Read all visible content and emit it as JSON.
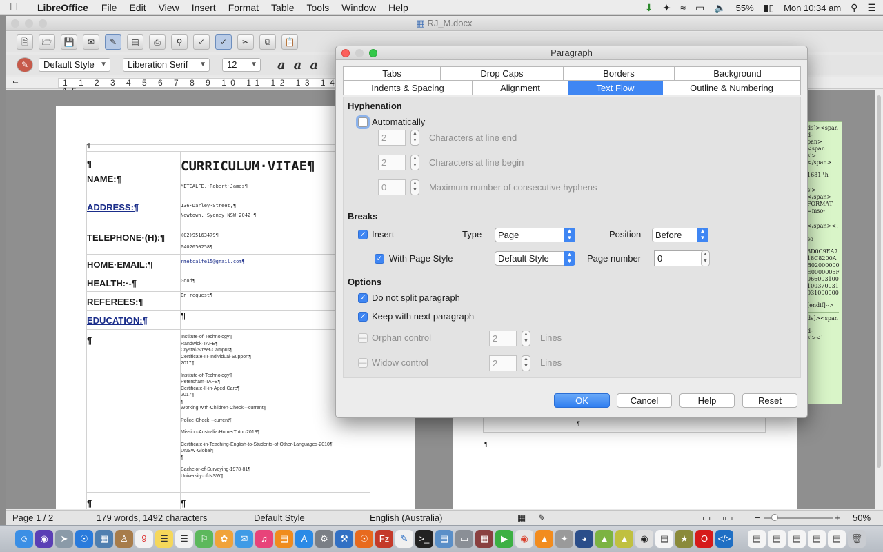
{
  "menubar": {
    "app_name": "LibreOffice",
    "items": [
      "File",
      "Edit",
      "View",
      "Insert",
      "Format",
      "Table",
      "Tools",
      "Window",
      "Help"
    ],
    "battery": "55%",
    "clock": "Mon 10:34 am"
  },
  "window": {
    "title": "RJ_M.docx"
  },
  "formatting": {
    "paragraph_style": "Default Style",
    "font_name": "Liberation Serif",
    "font_size": "12"
  },
  "ruler": {
    "marks": "1 1 2 3 4 5 6 7 8 9 10 11 12 13 14 15"
  },
  "document": {
    "cv_title": "CURRICULUM·VITAE¶",
    "name_label": "NAME:¶",
    "name_value": "METCALFE,·Robert·James¶",
    "address_label": "ADDRESS:¶",
    "address_line1": "136·Darley·Street,¶",
    "address_line2": "Newtown,·Sydney·NSW·2042·¶",
    "telephone_label": "TELEPHONE·(H):¶",
    "telephone1": "(02)95163479¶",
    "telephone2": "0402050258¶",
    "email_label": "HOME·EMAIL:¶",
    "email_value": "rmetcalfe15@gmail.com¶",
    "health_label": "HEALTH:·-¶",
    "health_value": "Good¶",
    "referees_label": "REFEREES:¶",
    "referees_value": "On·request¶",
    "education_label": "EDUCATION:¶",
    "education_lines": [
      "Institute·of·Technology¶",
      "Randwick·TAFE¶",
      "Crystal·Street·Campus¶",
      "Certificate·III·Individual·Support¶",
      "2017¶",
      "",
      "Institute·of·Technology¶",
      "Petersham·TAFE¶",
      "Certificate·II·in·Aged·Care¶",
      "2017¶",
      "¶",
      "Working·with·Children·Check·-·current¶",
      "",
      "Police·Check·-·current¶",
      "",
      "Mission·Australia·Home·Tutor·2013¶",
      "",
      "Certificate·in·Teaching·English·to·Students·of·Other·Languages·2010¶",
      "UNSW·Global¶",
      "¶",
      "",
      "Bachelor·of·Surveying·1978-81¶",
      "University·of·NSW¶"
    ],
    "pilcrow": "¶"
  },
  "markup_panel": {
    "lines_a": [
      "ds]><span",
      "d-",
      "pan><span",
      "s'> </span>",
      "1681 \\h",
      "s'> </span>",
      "FORMAT",
      "=mso-",
      "</span><!"
    ],
    "lines_b": [
      "so",
      "8D0C9EA7",
      "18C8200A",
      "B02000000",
      "E0000005F",
      "066003100",
      "100370031",
      "031000000",
      "[endif]-->"
    ],
    "lines_c": [
      "ds]><span",
      "d-",
      "s'><!"
    ]
  },
  "statusbar": {
    "page": "Page 1 / 2",
    "counts": "179 words, 1492 characters",
    "page_style": "Default Style",
    "language": "English (Australia)",
    "zoom": "50%"
  },
  "dialog": {
    "title": "Paragraph",
    "tabs_row1": [
      "Tabs",
      "Drop Caps",
      "Borders",
      "Background"
    ],
    "tabs_row2": [
      "Indents & Spacing",
      "Alignment",
      "Text Flow",
      "Outline & Numbering"
    ],
    "active_tab": "Text Flow",
    "hyphenation": {
      "heading": "Hyphenation",
      "automatically_label": "Automatically",
      "automatically_checked": false,
      "chars_line_end_label": "Characters at line end",
      "chars_line_end_value": "2",
      "chars_line_begin_label": "Characters at line begin",
      "chars_line_begin_value": "2",
      "max_hyphens_label": "Maximum number of consecutive hyphens",
      "max_hyphens_value": "0"
    },
    "breaks": {
      "heading": "Breaks",
      "insert_label": "Insert",
      "insert_checked": true,
      "type_label": "Type",
      "type_value": "Page",
      "position_label": "Position",
      "position_value": "Before",
      "with_page_style_label": "With Page Style",
      "with_page_style_checked": true,
      "page_style_value": "Default Style",
      "page_number_label": "Page number",
      "page_number_value": "0"
    },
    "options": {
      "heading": "Options",
      "do_not_split_label": "Do not split paragraph",
      "do_not_split_checked": true,
      "keep_with_next_label": "Keep with next paragraph",
      "keep_with_next_checked": true,
      "orphan_label": "Orphan control",
      "orphan_value": "2",
      "widow_label": "Widow control",
      "widow_value": "2",
      "lines_label": "Lines"
    },
    "buttons": {
      "ok": "OK",
      "cancel": "Cancel",
      "help": "Help",
      "reset": "Reset"
    }
  },
  "colors": {
    "accent": "#3f86f3",
    "link": "#1a2d8a",
    "markup_bg": "#d9f5c8"
  }
}
